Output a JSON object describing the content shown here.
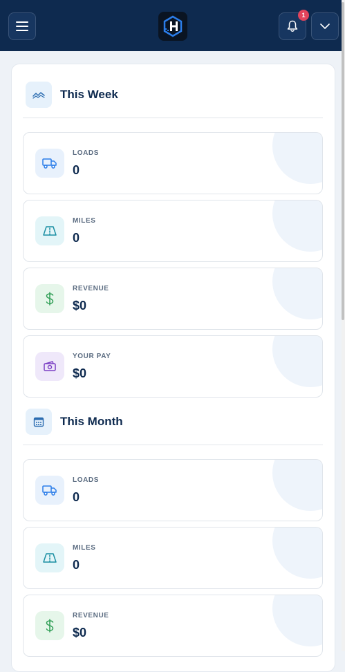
{
  "header": {
    "menu_icon": "hamburger-icon",
    "logo_icon": "app-logo",
    "notification_icon": "bell-icon",
    "notification_count": "1",
    "account_icon": "chevron-down-icon"
  },
  "week": {
    "title": "This Week",
    "icon": "trend-line-icon",
    "stats": [
      {
        "label": "LOADS",
        "value": "0",
        "icon": "truck-icon"
      },
      {
        "label": "MILES",
        "value": "0",
        "icon": "road-icon"
      },
      {
        "label": "REVENUE",
        "value": "$0",
        "icon": "dollar-icon"
      },
      {
        "label": "YOUR PAY",
        "value": "$0",
        "icon": "cash-icon"
      }
    ]
  },
  "month": {
    "title": "This Month",
    "icon": "calendar-icon",
    "stats": [
      {
        "label": "LOADS",
        "value": "0",
        "icon": "truck-icon"
      },
      {
        "label": "MILES",
        "value": "0",
        "icon": "road-icon"
      },
      {
        "label": "REVENUE",
        "value": "$0",
        "icon": "dollar-icon"
      }
    ]
  },
  "colors": {
    "navbar": "#0e2a4f",
    "badge": "#e2445c",
    "loads_icon_bg": "#e8f1fc",
    "miles_icon_bg": "#e3f5f8",
    "revenue_icon_bg": "#e6f6ea",
    "pay_icon_bg": "#efe8fa"
  }
}
